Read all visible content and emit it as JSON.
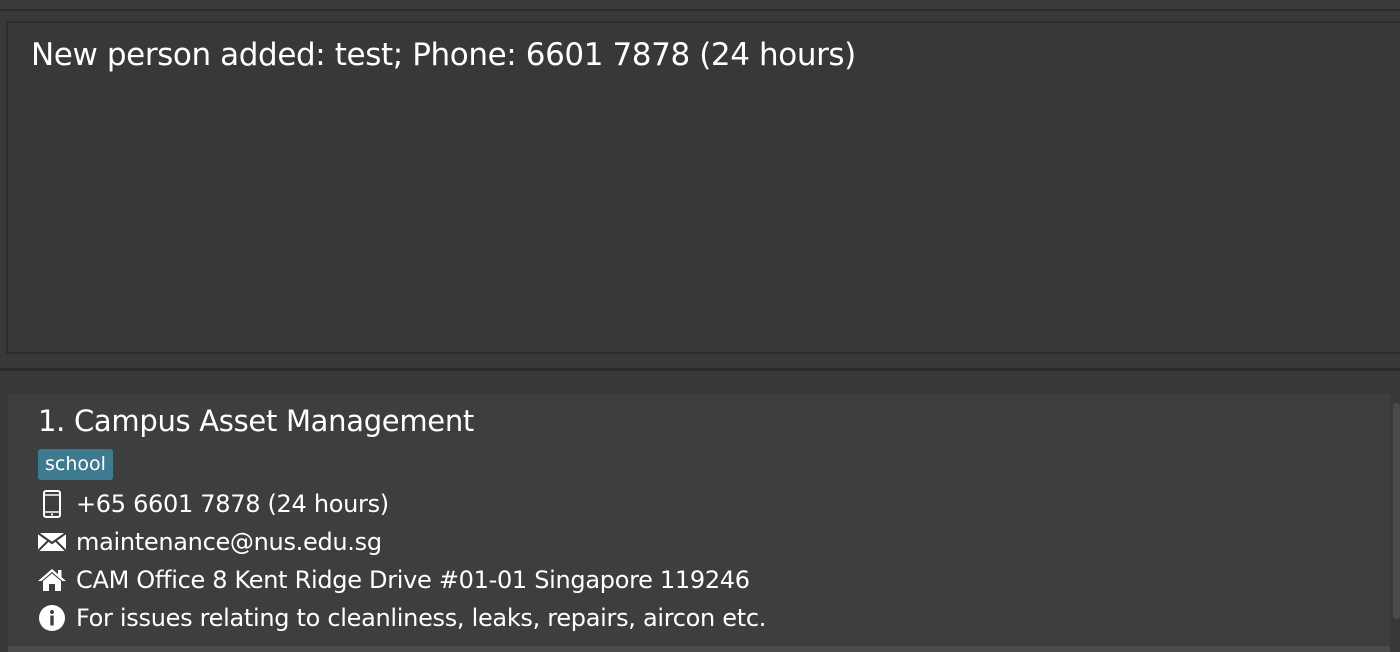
{
  "result_display": {
    "message": "New person added: test; Phone: 6601 7878 (24 hours)"
  },
  "person_list": {
    "cards": [
      {
        "index_name": "1. Campus Asset Management",
        "tags": [
          "school"
        ],
        "phone": "+65 6601 7878 (24 hours)",
        "email": "maintenance@nus.edu.sg",
        "address": "CAM Office 8 Kent Ridge Drive #01-01 Singapore 119246",
        "description": "For issues relating to cleanliness, leaks, repairs, aircon etc.",
        "icons": {
          "phone": "phone-icon",
          "email": "email-icon",
          "address": "home-icon",
          "description": "info-icon"
        }
      }
    ]
  },
  "colors": {
    "background": "#383838",
    "card": "#3c3e3f",
    "tag": "#3e7b91",
    "text": "#ffffff"
  }
}
